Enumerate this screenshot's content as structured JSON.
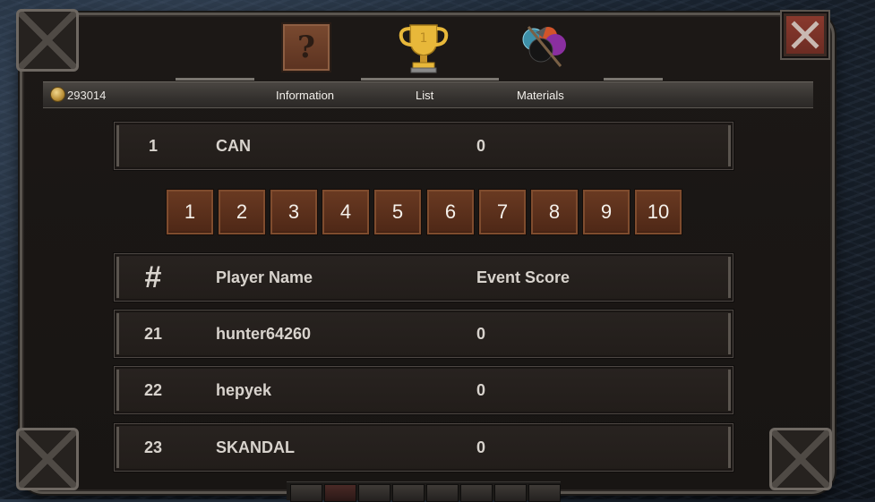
{
  "currency": {
    "icon": "coin-icon",
    "value": "293014"
  },
  "tabs": [
    {
      "label": "Information",
      "icon": "question-mark-icon"
    },
    {
      "label": "List",
      "icon": "trophy-icon"
    },
    {
      "label": "Materials",
      "icon": "materials-orbs-icon"
    }
  ],
  "trophy_rank": "1",
  "info_glyph": "?",
  "close": {
    "icon": "close-x-icon"
  },
  "my_entry": {
    "rank": "1",
    "name": "CAN",
    "score": "0"
  },
  "pagination": [
    "1",
    "2",
    "3",
    "4",
    "5",
    "6",
    "7",
    "8",
    "9",
    "10"
  ],
  "table": {
    "headers": {
      "rank": "#",
      "name": "Player Name",
      "score": "Event Score"
    },
    "rows": [
      {
        "rank": "21",
        "name": "hunter64260",
        "score": "0"
      },
      {
        "rank": "22",
        "name": "hepyek",
        "score": "0"
      },
      {
        "rank": "23",
        "name": "SKANDAL",
        "score": "0"
      }
    ]
  },
  "taskbar_icons": [
    "hero-icon",
    "close-red-icon",
    "helmet-icon",
    "hammer-icon",
    "anvil-icon",
    "fence-icon",
    "rifle-icon",
    "feather-icon"
  ],
  "colors": {
    "accent_brown": "#6a3a22",
    "close_red": "#8c3a2e",
    "panel_bg": "#1c1816",
    "text": "#d8d3cd"
  }
}
